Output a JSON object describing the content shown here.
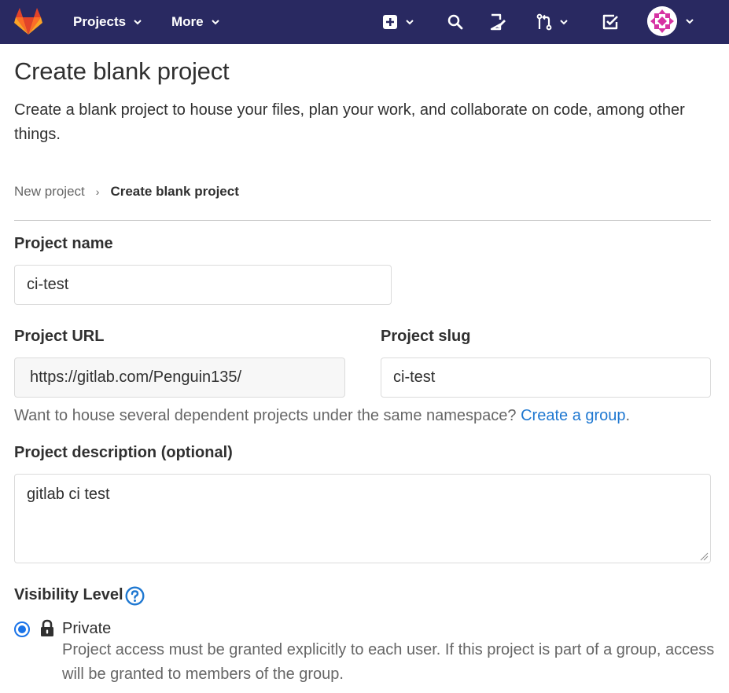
{
  "nav": {
    "projects_label": "Projects",
    "more_label": "More",
    "icons": [
      "plus-square-icon",
      "search-icon",
      "issues-icon",
      "merge-request-icon",
      "todo-icon"
    ],
    "avatar_icon": "avatar-identicon"
  },
  "page": {
    "title": "Create blank project",
    "description": "Create a blank project to house your files, plan your work, and collaborate on code, among other things."
  },
  "breadcrumb": {
    "parent": "New project",
    "separator": "›",
    "current": "Create blank project"
  },
  "form": {
    "project_name": {
      "label": "Project name",
      "value": "ci-test"
    },
    "project_url": {
      "label": "Project URL",
      "value": "https://gitlab.com/Penguin135/"
    },
    "project_slug": {
      "label": "Project slug",
      "value": "ci-test"
    },
    "namespace_helper": {
      "text": "Want to house several dependent projects under the same namespace?",
      "link": "Create a group",
      "suffix": "."
    },
    "description": {
      "label": "Project description (optional)",
      "value": "gitlab ci test"
    },
    "visibility": {
      "label": "Visibility Level",
      "option_label": "Private",
      "option_desc": "Project access must be granted explicitly to each user. If this project is part of a group, access will be granted to members of the group."
    }
  },
  "colors": {
    "navbar": "#292961",
    "link": "#1f78d1",
    "radio": "#1a73e8"
  }
}
